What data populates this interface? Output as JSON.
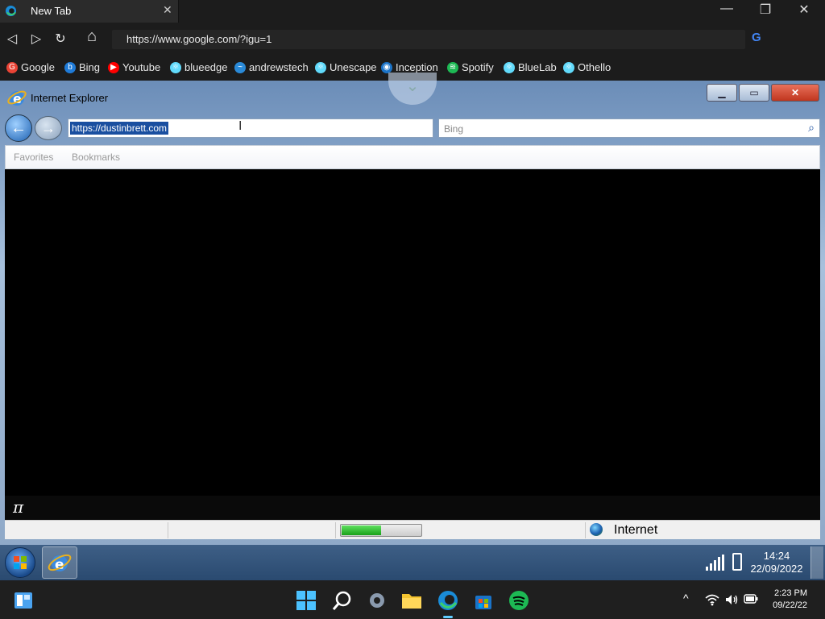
{
  "browser": {
    "tab": {
      "title": "New Tab",
      "close": "✕"
    },
    "window_controls": {
      "minimize": "—",
      "restore": "❐",
      "close": "✕"
    },
    "nav": {
      "back": "◁",
      "forward": "▷",
      "reload": "↻",
      "home": "⌂"
    },
    "address": "https://www.google.com/?igu=1",
    "google_icon": "G",
    "bookmarks": [
      {
        "label": "Google",
        "icon": "google-icon",
        "color": "#ea4335",
        "glyph": "G"
      },
      {
        "label": "Bing",
        "icon": "bing-icon",
        "color": "#1f7bd8",
        "glyph": "b"
      },
      {
        "label": "Youtube",
        "icon": "youtube-icon",
        "color": "#ff0000",
        "glyph": "▶"
      },
      {
        "label": "blueedge",
        "icon": "react-icon",
        "color": "#61dafb",
        "glyph": "⚛"
      },
      {
        "label": "andrewstech",
        "icon": "andrewstech-icon",
        "color": "#2a8ad8",
        "glyph": "~"
      },
      {
        "label": "Unescape",
        "icon": "react-icon",
        "color": "#61dafb",
        "glyph": "⚛"
      },
      {
        "label": "Inception",
        "icon": "inception-icon",
        "color": "#1a73c8",
        "glyph": "◉"
      },
      {
        "label": "Spotify",
        "icon": "spotify-icon",
        "color": "#1db954",
        "glyph": "≋"
      },
      {
        "label": "BlueLab",
        "icon": "react-icon",
        "color": "#61dafb",
        "glyph": "⚛"
      },
      {
        "label": "Othello",
        "icon": "react-icon",
        "color": "#61dafb",
        "glyph": "⚛"
      }
    ]
  },
  "ie": {
    "title": "Internet Explorer",
    "controls": {
      "minimize": "▁",
      "maximize": "▭",
      "close": "✕"
    },
    "chevron": "⌄",
    "back": "←",
    "forward": "→",
    "url": "https://dustinbrett.com",
    "search_placeholder": "Bing",
    "search_icon": "⌕",
    "favorites": "Favorites",
    "bookmarks": "Bookmarks",
    "footer_symbol": "π",
    "progress_fraction": 0.5,
    "zone": "Internet"
  },
  "win7_taskbar": {
    "time": "14:24",
    "date": "22/09/2022"
  },
  "win11_taskbar": {
    "tray_chevron": "^",
    "time": "2:23 PM",
    "date": "09/22/22"
  }
}
